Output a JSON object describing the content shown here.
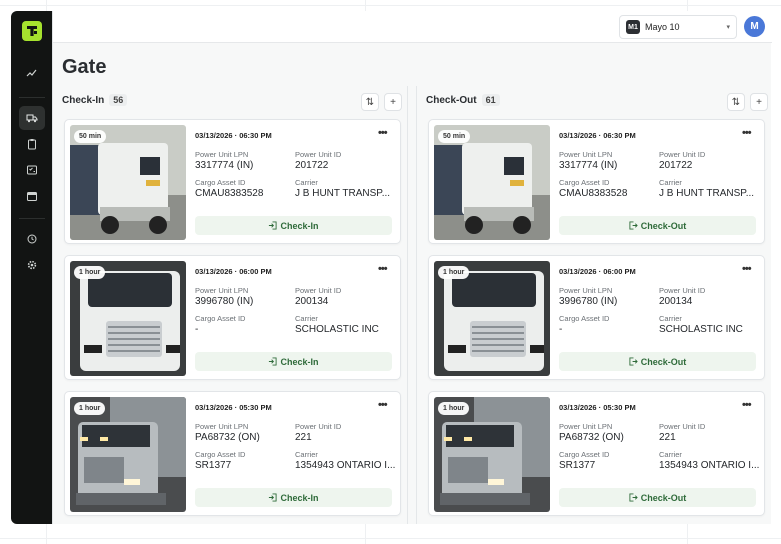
{
  "app": {
    "logo": "truck-logo-icon"
  },
  "topbar": {
    "location": {
      "badge": "M1",
      "name": "Mayo 10"
    },
    "avatar_initial": "M"
  },
  "page": {
    "title": "Gate"
  },
  "sidebar": {
    "items": [
      {
        "icon": "analytics-icon"
      },
      {
        "icon": "truck-icon",
        "active": true
      },
      {
        "icon": "clipboard-icon"
      },
      {
        "icon": "checklist-icon"
      },
      {
        "icon": "calendar-icon"
      },
      {
        "icon": "history-icon"
      },
      {
        "icon": "gear-icon"
      }
    ]
  },
  "checkin": {
    "title": "Check-In",
    "count": "56",
    "cards": [
      {
        "badge": "50 min",
        "datetime": "03/13/2026 · 06:30 PM",
        "lpn_label": "Power Unit LPN",
        "lpn": "3317774 (IN)",
        "unit_label": "Power Unit ID",
        "unit": "201722",
        "cargo_label": "Cargo Asset ID",
        "cargo": "CMAU8383528",
        "carrier_label": "Carrier",
        "carrier": "J B HUNT TRANSP...",
        "action": "Check-In"
      },
      {
        "badge": "1 hour",
        "datetime": "03/13/2026 · 06:00 PM",
        "lpn_label": "Power Unit LPN",
        "lpn": "3996780 (IN)",
        "unit_label": "Power Unit ID",
        "unit": "200134",
        "cargo_label": "Cargo Asset ID",
        "cargo": "-",
        "carrier_label": "Carrier",
        "carrier": "SCHOLASTIC INC",
        "action": "Check-In"
      },
      {
        "badge": "1 hour",
        "datetime": "03/13/2026 · 05:30 PM",
        "lpn_label": "Power Unit LPN",
        "lpn": "PA68732 (ON)",
        "unit_label": "Power Unit ID",
        "unit": "221",
        "cargo_label": "Cargo Asset ID",
        "cargo": "SR1377",
        "carrier_label": "Carrier",
        "carrier": "1354943 ONTARIO I...",
        "action": "Check-In"
      }
    ]
  },
  "checkout": {
    "title": "Check-Out",
    "count": "61",
    "cards": [
      {
        "badge": "50 min",
        "datetime": "03/13/2026 · 06:30 PM",
        "lpn_label": "Power Unit LPN",
        "lpn": "3317774 (IN)",
        "unit_label": "Power Unit ID",
        "unit": "201722",
        "cargo_label": "Cargo Asset ID",
        "cargo": "CMAU8383528",
        "carrier_label": "Carrier",
        "carrier": "J B HUNT TRANSP...",
        "action": "Check-Out"
      },
      {
        "badge": "1 hour",
        "datetime": "03/13/2026 · 06:00 PM",
        "lpn_label": "Power Unit LPN",
        "lpn": "3996780 (IN)",
        "unit_label": "Power Unit ID",
        "unit": "200134",
        "cargo_label": "Cargo Asset ID",
        "cargo": "-",
        "carrier_label": "Carrier",
        "carrier": "SCHOLASTIC INC",
        "action": "Check-Out"
      },
      {
        "badge": "1 hour",
        "datetime": "03/13/2026 · 05:30 PM",
        "lpn_label": "Power Unit LPN",
        "lpn": "PA68732 (ON)",
        "unit_label": "Power Unit ID",
        "unit": "221",
        "cargo_label": "Cargo Asset ID",
        "cargo": "SR1377",
        "carrier_label": "Carrier",
        "carrier": "1354943 ONTARIO I...",
        "action": "Check-Out"
      }
    ]
  },
  "colors": {
    "sidebar": "#121413",
    "brand": "#a6e22e",
    "action_bg": "#eef5ee",
    "action_text": "#2f6b3a",
    "avatar": "#4a78d8"
  }
}
